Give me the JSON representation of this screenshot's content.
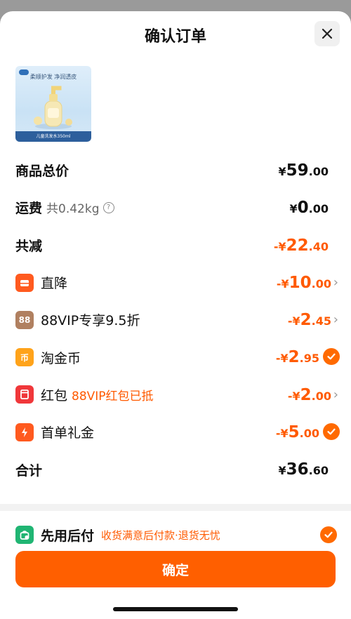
{
  "header": {
    "title": "确认订单"
  },
  "product": {
    "slogan": "柔顺护发 净润透皮",
    "bottom_caption": "儿童洗发水350ml"
  },
  "rows": [
    {
      "label": "商品总价",
      "price": {
        "yuan": "¥",
        "int": "59",
        "dec": ".00"
      },
      "color": "black"
    },
    {
      "label": "运费",
      "sub": "共0.42kg",
      "price": {
        "yuan": "¥",
        "int": "0",
        "dec": ".00"
      },
      "color": "black"
    },
    {
      "label": "共减",
      "price": {
        "yuan": "-¥",
        "int": "22",
        "dec": ".40"
      },
      "color": "orange"
    },
    {
      "label": "直降",
      "icon": "discount-icon",
      "price": {
        "yuan": "-¥",
        "int": "10",
        "dec": ".00"
      },
      "color": "orange",
      "trail": "chevron"
    },
    {
      "label": "88VIP专享9.5折",
      "icon": "88vip-icon",
      "icon_text": "88",
      "price": {
        "yuan": "-¥",
        "int": "2",
        "dec": ".45"
      },
      "color": "orange",
      "trail": "chevron"
    },
    {
      "label": "淘金币",
      "icon": "coin-icon",
      "icon_text": "币",
      "price": {
        "yuan": "-¥",
        "int": "2",
        "dec": ".95"
      },
      "color": "orange",
      "trail": "check"
    },
    {
      "label": "红包",
      "note": "88VIP红包已抵",
      "icon": "red-packet-icon",
      "price": {
        "yuan": "-¥",
        "int": "2",
        "dec": ".00"
      },
      "color": "orange",
      "trail": "chevron"
    },
    {
      "label": "首单礼金",
      "icon": "lightning-icon",
      "price": {
        "yuan": "-¥",
        "int": "5",
        "dec": ".00"
      },
      "color": "orange",
      "trail": "check"
    },
    {
      "label": "合计",
      "price": {
        "yuan": "¥",
        "int": "36",
        "dec": ".60"
      },
      "color": "black"
    }
  ],
  "pay_later": {
    "label": "先用后付",
    "description": "收货满意后付款·退货无忧"
  },
  "confirm_button": {
    "label": "确定"
  },
  "colors": {
    "accent_orange": "#ff5f00",
    "pay_later_green": "#20b573"
  }
}
